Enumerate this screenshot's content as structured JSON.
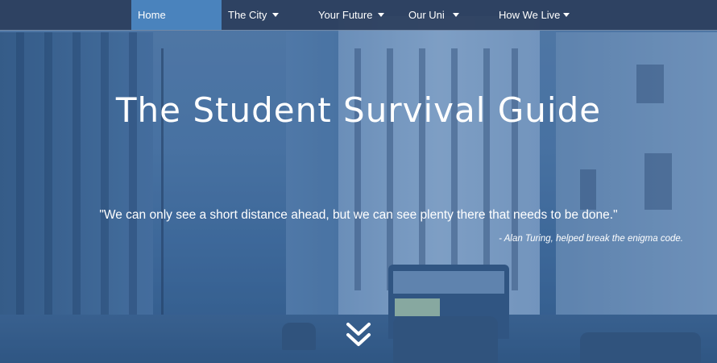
{
  "nav": {
    "items": [
      {
        "label": "Home",
        "active": true,
        "has_dropdown": false
      },
      {
        "label": "The City",
        "active": false,
        "has_dropdown": true
      },
      {
        "label": "Your Future",
        "active": false,
        "has_dropdown": true
      },
      {
        "label": "Our Uni",
        "active": false,
        "has_dropdown": true
      },
      {
        "label": "How We Live",
        "active": false,
        "has_dropdown": true
      }
    ]
  },
  "hero": {
    "title": "The Student Survival Guide",
    "quote": "\"We can only see a short distance ahead, but we can see plenty there that needs to be done.\"",
    "attribution": "-  Alan Turing, helped break the enigma code.",
    "scroll_icon": "double-chevron-down-icon"
  },
  "colors": {
    "nav_bg": "#2c3e5c",
    "nav_active": "#4a83bd",
    "overlay_tint": "#3764a0",
    "text": "#ffffff"
  }
}
